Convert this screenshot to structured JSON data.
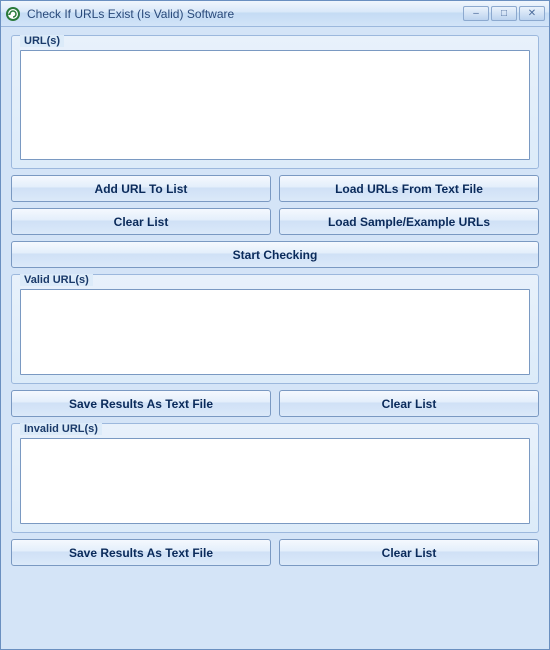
{
  "window": {
    "title": "Check If URLs Exist (Is Valid) Software"
  },
  "groups": {
    "url": {
      "legend": "URL(s)"
    },
    "valid": {
      "legend": "Valid URL(s)"
    },
    "invalid": {
      "legend": "Invalid URL(s)"
    }
  },
  "buttons": {
    "add_url": "Add URL To List",
    "load_file": "Load URLs From Text File",
    "clear_list_top": "Clear List",
    "load_sample": "Load Sample/Example URLs",
    "start_checking": "Start Checking",
    "save_valid": "Save Results As Text File",
    "clear_valid": "Clear List",
    "save_invalid": "Save Results As Text File",
    "clear_invalid": "Clear List"
  },
  "titlebar_controls": {
    "minimize": "–",
    "maximize": "□",
    "close": "✕"
  }
}
